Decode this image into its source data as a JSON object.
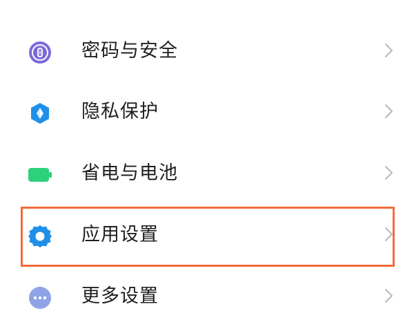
{
  "settings_list": {
    "items": [
      {
        "label": "密码与安全",
        "icon": "fingerprint-icon",
        "icon_color": "#7b6ad8"
      },
      {
        "label": "隐私保护",
        "icon": "privacy-shield-icon",
        "icon_color": "#1f8fe8"
      },
      {
        "label": "省电与电池",
        "icon": "battery-icon",
        "icon_color": "#2ed07b"
      },
      {
        "label": "应用设置",
        "icon": "gear-icon",
        "icon_color": "#1f8fe8"
      },
      {
        "label": "更多设置",
        "icon": "more-dots-icon",
        "icon_color": "#8fa3e6"
      }
    ],
    "highlighted_item": "应用设置",
    "highlight_color": "#f26b3a",
    "chevron_color": "#b8b8b8"
  }
}
